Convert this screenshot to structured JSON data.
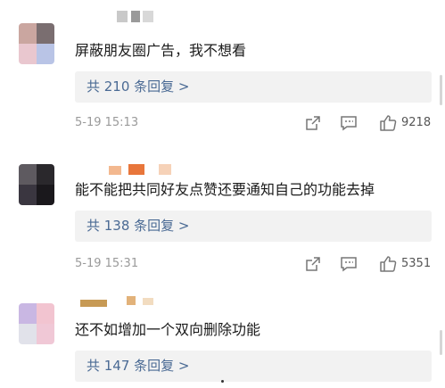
{
  "comments": [
    {
      "text": "屏蔽朋友圈广告，我不想看",
      "reply_label": "共 210 条回复 >",
      "time": "5-19 15:13",
      "likes": "9218",
      "avatar_colors": [
        "#caa6a0",
        "#7a6e70",
        "#e9c7cf",
        "#b9c4e6"
      ],
      "nick_colors": [
        "#c9c9c9",
        "#9a9a9a",
        "#d8d8d8"
      ]
    },
    {
      "text": "能不能把共同好友点赞还要通知自己的功能去掉",
      "reply_label": "共 138 条回复 >",
      "time": "5-19 15:31",
      "likes": "5351",
      "avatar_colors": [
        "#5e5a60",
        "#2a282c",
        "#3a3640",
        "#1a181c"
      ],
      "nick_colors": [
        "#f3b88f",
        "#e8763b",
        "#f6d2b8"
      ]
    },
    {
      "text": "还不如增加一个双向删除功能",
      "reply_label": "共 147 条回复 >",
      "avatar_colors": [
        "#c9b7e3",
        "#f2c4d0",
        "#e1e2ea",
        "#f0c8d6"
      ],
      "nick_colors": [
        "#c79a55",
        "#e2b27a",
        "#f2dcc0"
      ]
    }
  ],
  "icons": {
    "share": "share-icon",
    "reply": "reply-icon",
    "like": "thumbs-up-icon"
  }
}
